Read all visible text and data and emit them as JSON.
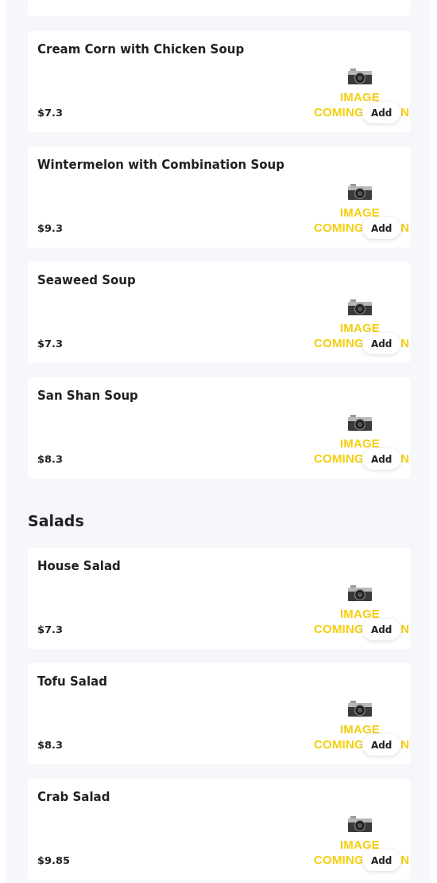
{
  "sections": [
    {
      "items": [
        {
          "name": "Cream Corn with Chicken Soup",
          "price": "$7.3",
          "image": {
            "line_1": "IMAGE",
            "line_2": "COMING",
            "line_2_end": "N"
          },
          "button": "Add"
        },
        {
          "name": "Wintermelon with Combination Soup",
          "price": "$9.3",
          "image": {
            "line_1": "IMAGE",
            "line_2": "COMING",
            "line_2_end": "N"
          },
          "button": "Add"
        },
        {
          "name": "Seaweed Soup",
          "price": "$7.3",
          "image": {
            "line_1": "IMAGE",
            "line_2": "COMING",
            "line_2_end": "N"
          },
          "button": "Add"
        },
        {
          "name": "San Shan Soup",
          "price": "$8.3",
          "image": {
            "line_1": "IMAGE",
            "line_2": "COMING",
            "line_2_end": "N"
          },
          "button": "Add"
        }
      ]
    },
    {
      "title": "Salads",
      "items": [
        {
          "name": "House Salad",
          "price": "$7.3",
          "image": {
            "line_1": "IMAGE",
            "line_2": "COMING",
            "line_2_end": "N"
          },
          "button": "Add"
        },
        {
          "name": "Tofu Salad",
          "price": "$8.3",
          "image": {
            "line_1": "IMAGE",
            "line_2": "COMING",
            "line_2_end": "N"
          },
          "button": "Add"
        },
        {
          "name": "Crab Salad",
          "price": "$9.85",
          "image": {
            "line_1": "IMAGE",
            "line_2": "COMING",
            "line_2_end": "N"
          },
          "button": "Add"
        }
      ]
    }
  ]
}
